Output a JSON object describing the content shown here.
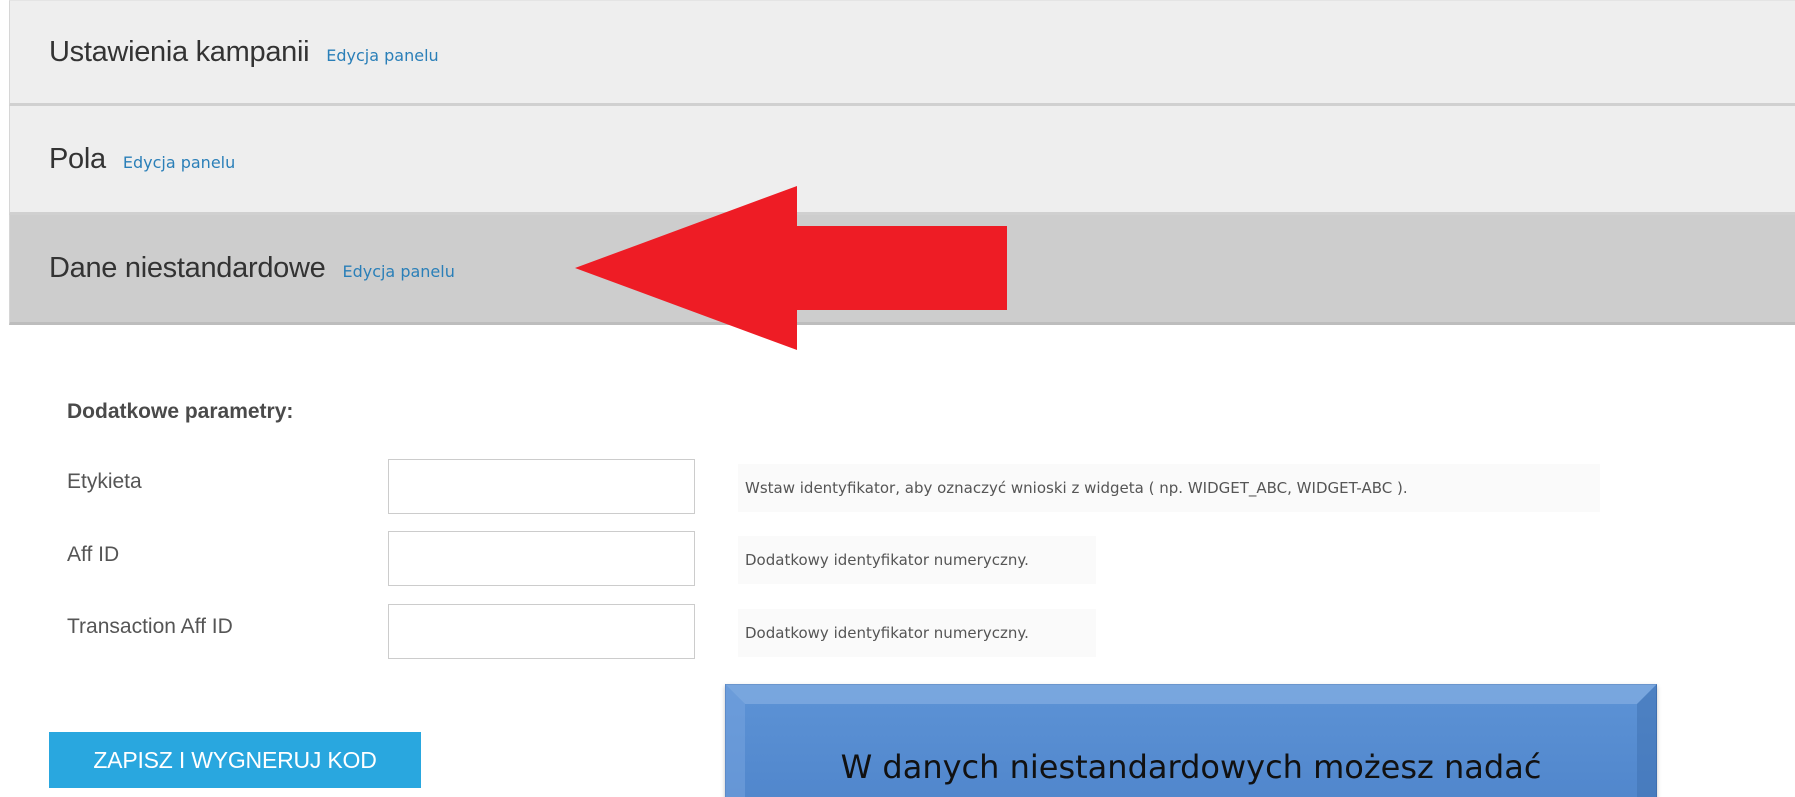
{
  "panels": [
    {
      "title": "Ustawienia kampanii",
      "edit_label": "Edycja panelu",
      "active": false
    },
    {
      "title": "Pola",
      "edit_label": "Edycja panelu",
      "active": false
    },
    {
      "title": "Dane niestandardowe",
      "edit_label": "Edycja panelu",
      "active": true
    }
  ],
  "form": {
    "section_title": "Dodatkowe parametry:",
    "fields": [
      {
        "label": "Etykieta",
        "value": "",
        "hint": "Wstaw identyfikator, aby oznaczyć wnioski z widgeta ( np. WIDGET_ABC, WIDGET-ABC )."
      },
      {
        "label": "Aff ID",
        "value": "",
        "hint": "Dodatkowy identyfikator numeryczny."
      },
      {
        "label": "Transaction Aff ID",
        "value": "",
        "hint": "Dodatkowy identyfikator numeryczny."
      }
    ],
    "save_label": "ZAPISZ I WYGNERUJ KOD"
  },
  "annotation": {
    "callout_text": "W danych niestandardowych możesz nadać",
    "arrow_icon": "red-arrow-left-icon"
  },
  "colors": {
    "link": "#2a7fb8",
    "button": "#29a7df",
    "arrow": "#ee1c25",
    "callout": "#5b8fd4",
    "panel_light": "#eeeeee",
    "panel_active": "#cdcdcd"
  }
}
